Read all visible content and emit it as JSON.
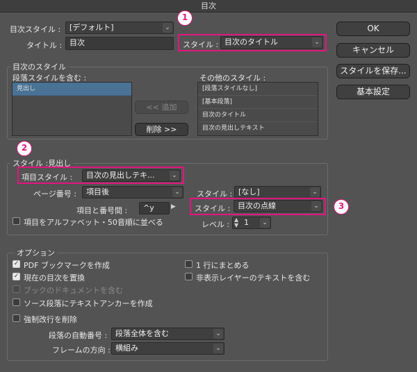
{
  "window": {
    "title": "目次"
  },
  "top": {
    "toc_style_label": "目次スタイル :",
    "toc_style_value": "[デフォルト]",
    "title_label": "タイトル :",
    "title_value": "目次",
    "title_style_label": "スタイル :",
    "title_style_value": "目次のタイトル"
  },
  "buttons": {
    "ok": "OK",
    "cancel": "キャンセル",
    "save_style": "スタイルを保存...",
    "basic": "基本設定"
  },
  "toc_styles_group": {
    "label": "目次のスタイル",
    "include_label": "段落スタイルを含む :",
    "include_items": [
      "見出し"
    ],
    "add_button": "<< 追加",
    "remove_button": "削除 >>",
    "other_label": "その他のスタイル :",
    "other_items": [
      "[段落スタイルなし]",
      "[基本段落]",
      "目次のタイトル",
      "目次の見出しテキスト"
    ]
  },
  "style_group": {
    "label": "スタイル :見出し",
    "entry_style_label": "項目スタイル :",
    "entry_style_value": "目次の見出しテキ...",
    "page_number_label": "ページ番号 :",
    "page_number_value": "項目後",
    "page_number_style_label": "スタイル :",
    "page_number_style_value": "[なし]",
    "between_label": "項目と番号間 :",
    "between_value": "^y",
    "between_style_label": "スタイル :",
    "between_style_value": "目次の点線",
    "sort_label": "項目をアルファベット・50音順に並べる",
    "sort_checked": false,
    "level_label": "レベル :",
    "level_value": "1"
  },
  "options_group": {
    "label": "オプション",
    "pdf_bookmarks": {
      "label": "PDF ブックマークを作成",
      "checked": true
    },
    "replace_toc": {
      "label": "現在の目次を置換",
      "checked": true
    },
    "include_book": {
      "label": "ブックのドキュメントを含む",
      "checked": false,
      "disabled": true
    },
    "create_anchor": {
      "label": "ソース段落にテキストアンカーを作成",
      "checked": false
    },
    "remove_breaks": {
      "label": "強制改行を削除",
      "checked": false
    },
    "run_in": {
      "label": "1 行にまとめる",
      "checked": false
    },
    "hidden_layers": {
      "label": "非表示レイヤーのテキストを含む",
      "checked": false
    },
    "numbered_label": "段落の自動番号 :",
    "numbered_value": "段落全体を含む",
    "frame_dir_label": "フレームの方向 :",
    "frame_dir_value": "横組み"
  },
  "badges": {
    "one": "1",
    "two": "2",
    "three": "3"
  },
  "colors": {
    "highlight": "#e4157e",
    "background": "#535353",
    "selected_row": "#4a7295"
  }
}
